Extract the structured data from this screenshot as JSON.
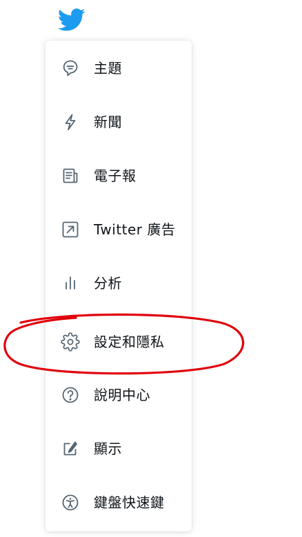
{
  "menu": {
    "items": [
      {
        "label": "主題",
        "icon": "topics-icon"
      },
      {
        "label": "新聞",
        "icon": "lightning-icon"
      },
      {
        "label": "電子報",
        "icon": "newsletter-icon"
      },
      {
        "label": "Twitter 廣告",
        "icon": "external-link-icon"
      },
      {
        "label": "分析",
        "icon": "analytics-icon"
      },
      {
        "label": "設定和隱私",
        "icon": "gear-icon"
      },
      {
        "label": "說明中心",
        "icon": "help-icon"
      },
      {
        "label": "顯示",
        "icon": "display-icon"
      },
      {
        "label": "鍵盤快速鍵",
        "icon": "accessibility-icon"
      }
    ]
  },
  "colors": {
    "brand": "#1d9bf0",
    "text": "#0f1419",
    "icon": "#536471",
    "annotation": "#e0000b"
  }
}
